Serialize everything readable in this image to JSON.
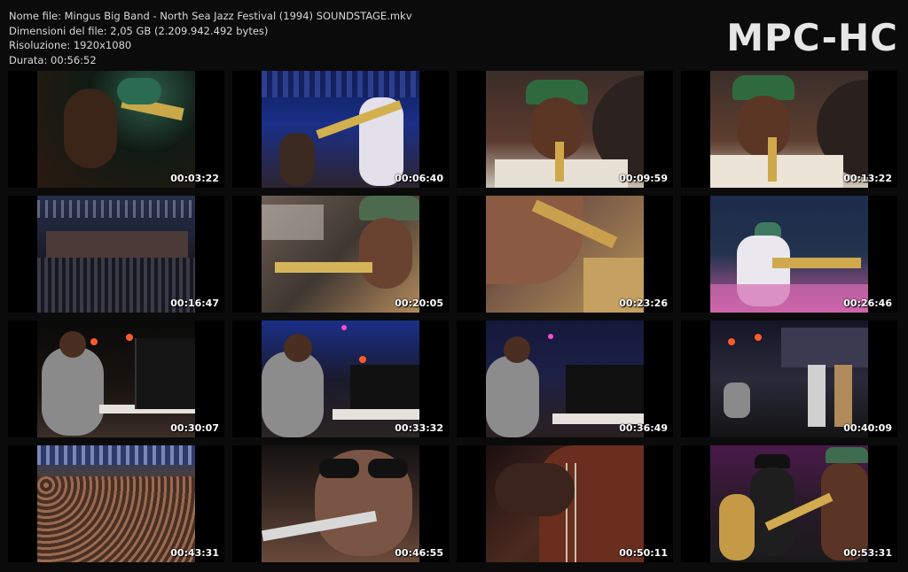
{
  "info": {
    "filename": "Nome file: Mingus Big Band - North Sea Jazz Festival (1994) SOUNDSTAGE.mkv",
    "filesize": "Dimensioni del file: 2,05 GB (2.209.942.492 bytes)",
    "resolution": "Risoluzione: 1920x1080",
    "duration": "Durata: 00:56:52"
  },
  "brand": "MPC-HC",
  "thumbnails": [
    {
      "timestamp": "00:03:22"
    },
    {
      "timestamp": "00:06:40"
    },
    {
      "timestamp": "00:09:59"
    },
    {
      "timestamp": "00:13:22"
    },
    {
      "timestamp": "00:16:47"
    },
    {
      "timestamp": "00:20:05"
    },
    {
      "timestamp": "00:23:26"
    },
    {
      "timestamp": "00:26:46"
    },
    {
      "timestamp": "00:30:07"
    },
    {
      "timestamp": "00:33:32"
    },
    {
      "timestamp": "00:36:49"
    },
    {
      "timestamp": "00:40:09"
    },
    {
      "timestamp": "00:43:31"
    },
    {
      "timestamp": "00:46:55"
    },
    {
      "timestamp": "00:50:11"
    },
    {
      "timestamp": "00:53:31"
    }
  ]
}
